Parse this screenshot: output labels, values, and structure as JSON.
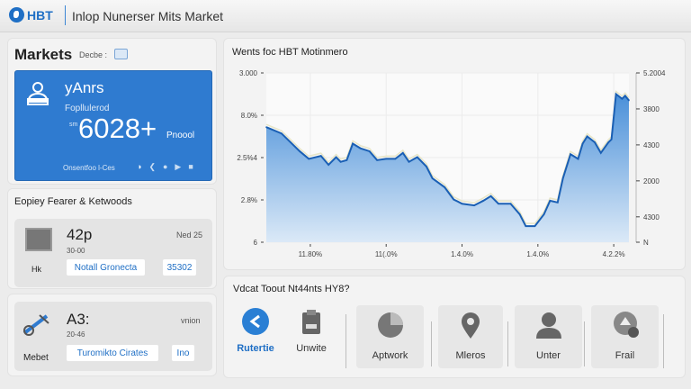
{
  "header": {
    "logo_text": "HBT",
    "title": "Inlop Nunerser Mits Market"
  },
  "markets": {
    "title": "Markets",
    "subtitle": "Decbe :",
    "card": {
      "name": "yAnrs",
      "label": "Fopllulerod",
      "prefix": "sm",
      "value": "6028+",
      "suffix": "Pnoool",
      "footer": "Onsentfoo l-Ces"
    }
  },
  "featured": {
    "title": "Eopiey Fearer & Ketwoods",
    "items": [
      {
        "icon_label": "Hk",
        "value": "42p",
        "sub": "30-00",
        "date": "Ned 25",
        "button": "Notall Gronecta",
        "tag": "35302"
      },
      {
        "icon_label": "Mebet",
        "value": "A3:",
        "sub": "20-46",
        "date": "vnion",
        "button": "Turomikto Cirates",
        "tag": "Ino"
      }
    ]
  },
  "chart_panel": {
    "title": "Wents foc HBT Motinmero"
  },
  "chart_data": {
    "type": "area",
    "title": "Wents foc HBT Motinmero",
    "left_ticks": [
      "6",
      "2.8%",
      "2.5%4",
      "8.0%",
      "3.000"
    ],
    "right_ticks": [
      {
        "label": "N",
        "at": 0
      },
      {
        "label": "4300",
        "at": 0.6
      },
      {
        "label": "2000",
        "at": 1.45
      },
      {
        "label": "4300",
        "at": 2.3
      },
      {
        "label": "3800",
        "at": 3.15
      },
      {
        "label": "5.2004",
        "at": 4
      }
    ],
    "x_ticks": [
      {
        "label": "11.80%",
        "at": 1
      },
      {
        "label": "11(.0%",
        "at": 2
      },
      {
        "label": "1.4.0%",
        "at": 3
      },
      {
        "label": "1.4.0%",
        "at": 4
      },
      {
        "label": "4.2.2%",
        "at": 5
      }
    ],
    "xlim": [
      0.42,
      5.2
    ],
    "ylim": [
      0,
      4
    ],
    "grid": true,
    "colors": {
      "line": "#1a5fb4",
      "fill": "#4a90d9"
    },
    "points": [
      [
        0.42,
        2.72
      ],
      [
        0.62,
        2.57
      ],
      [
        0.74,
        2.36
      ],
      [
        0.86,
        2.15
      ],
      [
        0.98,
        1.97
      ],
      [
        1.14,
        2.04
      ],
      [
        1.24,
        1.83
      ],
      [
        1.34,
        2.01
      ],
      [
        1.4,
        1.9
      ],
      [
        1.48,
        1.94
      ],
      [
        1.56,
        2.33
      ],
      [
        1.66,
        2.22
      ],
      [
        1.78,
        2.15
      ],
      [
        1.88,
        1.94
      ],
      [
        2.0,
        1.97
      ],
      [
        2.12,
        1.97
      ],
      [
        2.22,
        2.11
      ],
      [
        2.3,
        1.9
      ],
      [
        2.41,
        2.01
      ],
      [
        2.53,
        1.79
      ],
      [
        2.61,
        1.51
      ],
      [
        2.77,
        1.3
      ],
      [
        2.89,
        1.01
      ],
      [
        3.0,
        0.91
      ],
      [
        3.16,
        0.87
      ],
      [
        3.28,
        0.98
      ],
      [
        3.38,
        1.09
      ],
      [
        3.48,
        0.91
      ],
      [
        3.64,
        0.91
      ],
      [
        3.76,
        0.66
      ],
      [
        3.84,
        0.38
      ],
      [
        3.96,
        0.38
      ],
      [
        4.08,
        0.66
      ],
      [
        4.16,
        0.98
      ],
      [
        4.26,
        0.94
      ],
      [
        4.33,
        1.51
      ],
      [
        4.43,
        2.08
      ],
      [
        4.53,
        1.97
      ],
      [
        4.59,
        2.33
      ],
      [
        4.65,
        2.5
      ],
      [
        4.75,
        2.36
      ],
      [
        4.83,
        2.11
      ],
      [
        4.93,
        2.36
      ],
      [
        4.97,
        2.43
      ],
      [
        5.03,
        3.5
      ],
      [
        5.11,
        3.39
      ],
      [
        5.15,
        3.46
      ],
      [
        5.2,
        3.35
      ]
    ]
  },
  "quick": {
    "title": "Vdcat Toout Nt44nts HY8?",
    "items": [
      {
        "label": "Rutertie",
        "icon": "compass-icon",
        "active": true
      },
      {
        "label": "Unwite",
        "icon": "clipboard-icon"
      },
      {
        "label": "Aptwork",
        "icon": "globe-icon"
      },
      {
        "label": "Mleros",
        "icon": "map-pin-icon"
      },
      {
        "label": "Unter",
        "icon": "user-icon"
      },
      {
        "label": "Frail",
        "icon": "upload-icon"
      }
    ],
    "accent": "#1f6fc5"
  }
}
